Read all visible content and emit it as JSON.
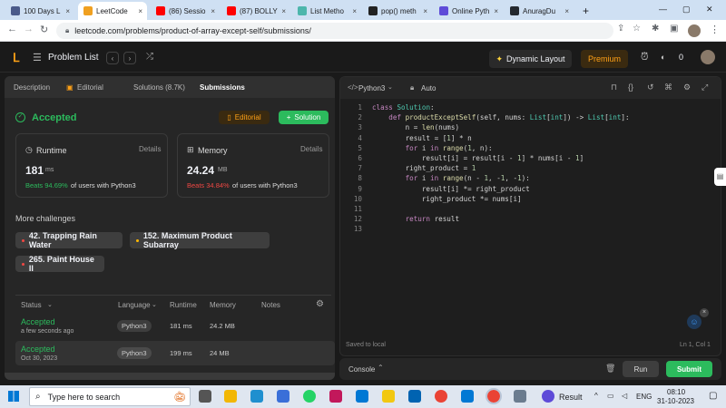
{
  "browser": {
    "tabs": [
      {
        "label": "100 Days L",
        "color": "#4a5a8a"
      },
      {
        "label": "LeetCode",
        "color": "#f0a020"
      },
      {
        "label": "(86) Sessio",
        "color": "#ff0000"
      },
      {
        "label": "(87) BOLLY",
        "color": "#ff0000"
      },
      {
        "label": "List Metho",
        "color": "#4db6ac"
      },
      {
        "label": "pop() meth",
        "color": "#222222"
      },
      {
        "label": "Online Pyth",
        "color": "#5e4bd8"
      },
      {
        "label": "AnuragDu",
        "color": "#24292f"
      }
    ],
    "new_tab": "+",
    "url": "leetcode.com/problems/product-of-array-except-self/submissions/"
  },
  "nav": {
    "problem_list": "Problem List",
    "dynamic_layout": "Dynamic Layout",
    "premium": "Premium",
    "coins": "0"
  },
  "left": {
    "tabs": [
      "Description",
      "Editorial",
      "Solutions (8.7K)",
      "Submissions"
    ],
    "status": "Accepted",
    "editorial_btn": "Editorial",
    "solution_btn": "Solution",
    "runtime": {
      "title": "Runtime",
      "details": "Details",
      "value": "181",
      "unit": "ms",
      "beats": "Beats 94.69%",
      "suffix": "of users with Python3"
    },
    "memory": {
      "title": "Memory",
      "details": "Details",
      "value": "24.24",
      "unit": "MB",
      "beats": "Beats 34.84%",
      "suffix": "of users with Python3"
    },
    "more_title": "More challenges",
    "challenges": [
      {
        "label": "42. Trapping Rain Water",
        "color": "#ef4743"
      },
      {
        "label": "152. Maximum Product Subarray",
        "color": "#ffb800"
      },
      {
        "label": "265. Paint House II",
        "color": "#ef4743"
      }
    ],
    "table_headers": {
      "status": "Status",
      "language": "Language",
      "runtime": "Runtime",
      "memory": "Memory",
      "notes": "Notes"
    },
    "rows": [
      {
        "status": "Accepted",
        "date": "a few seconds ago",
        "language": "Python3",
        "runtime": "181 ms",
        "memory": "24.2 MB"
      },
      {
        "status": "Accepted",
        "date": "Oct 30, 2023",
        "language": "Python3",
        "runtime": "199 ms",
        "memory": "24 MB"
      }
    ]
  },
  "editor": {
    "language": "Python3",
    "mode": "Auto",
    "lines": [
      "class Solution:",
      "    def productExceptSelf(self, nums: List[int]) -> List[int]:",
      "        n = len(nums)",
      "        result = [1] * n",
      "        for i in range(1, n):",
      "            result[i] = result[i - 1] * nums[i - 1]",
      "        right_product = 1",
      "        for i in range(n - 1, -1, -1):",
      "            result[i] *= right_product",
      "            right_product *= nums[i]",
      "",
      "        return result",
      ""
    ],
    "saved": "Saved to local",
    "cursor": "Ln 1, Col 1",
    "console": "Console",
    "run": "Run",
    "submit": "Submit"
  },
  "taskbar": {
    "search_placeholder": "Type here to search",
    "result_app": "Result",
    "lang": "ENG",
    "time": "08:10",
    "date": "31-10-2023"
  }
}
